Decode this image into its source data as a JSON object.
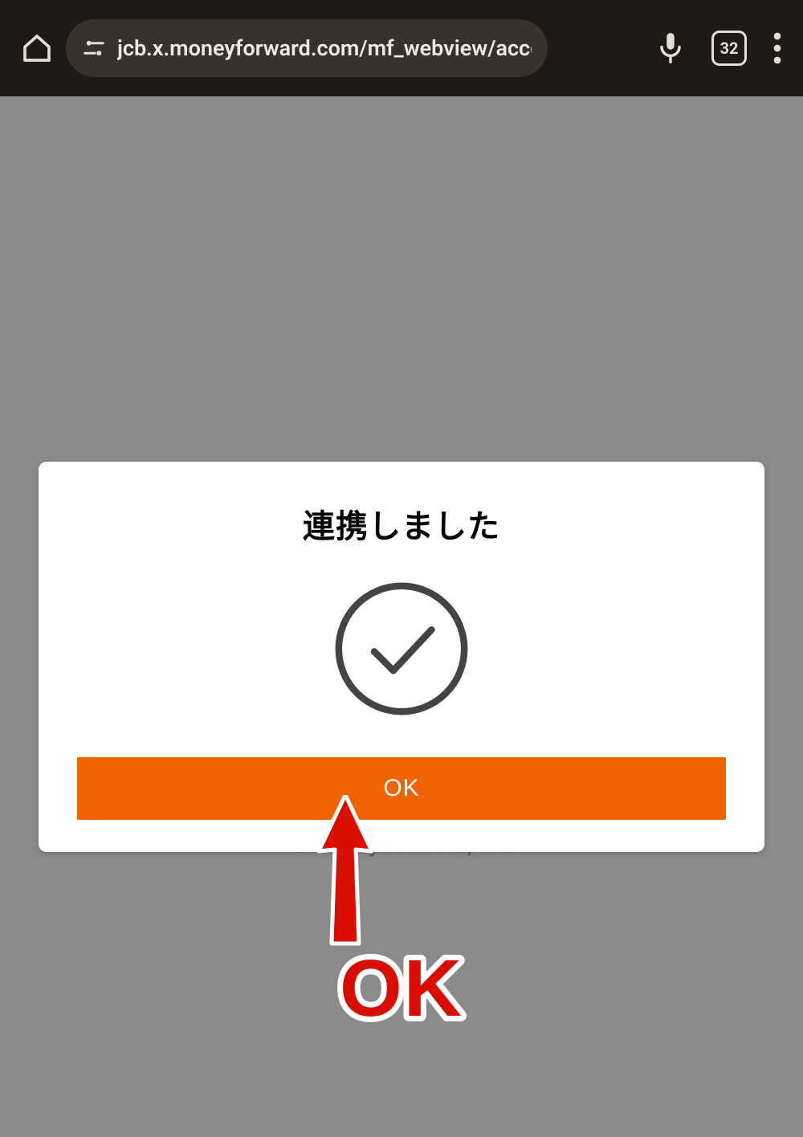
{
  "browser": {
    "url_display": "jcb.x.moneyforward.com/mf_webview/accou",
    "tab_count": "32"
  },
  "page": {
    "copyright": "© Money Forward, Inc."
  },
  "dialog": {
    "title": "連携しました",
    "ok_label": "OK"
  },
  "annotation": {
    "label": "OK"
  },
  "colors": {
    "accent": "#f06400",
    "annotation_red": "#d80f00",
    "bar_bg": "#1f1a14",
    "url_pill_bg": "#3a3229",
    "page_gray": "#8b8b8b"
  }
}
